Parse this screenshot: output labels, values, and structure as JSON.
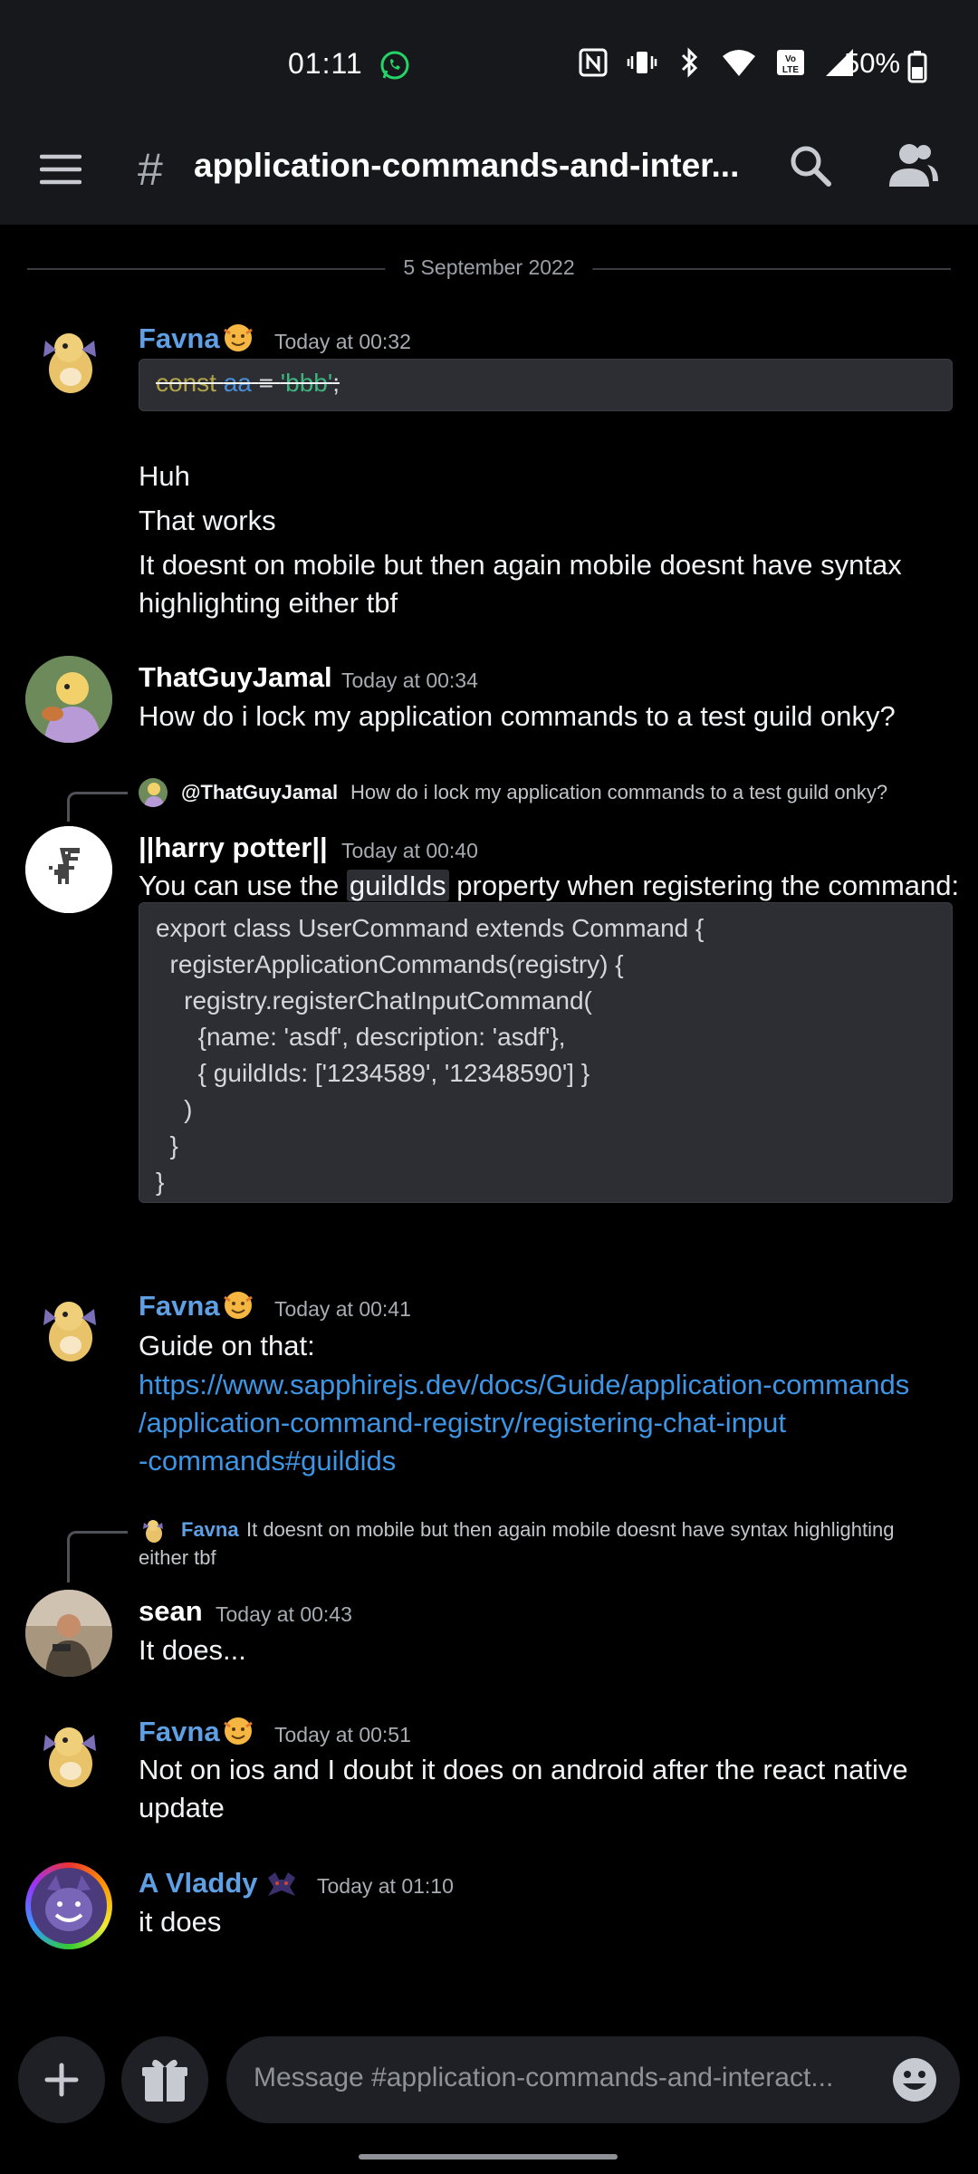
{
  "status_bar": {
    "time": "01:11",
    "battery": "50%"
  },
  "header": {
    "channel": "application-commands-and-inter...",
    "hash": "#"
  },
  "date_divider": "5 September 2022",
  "messages": {
    "m1": {
      "author": "Favna",
      "timestamp": "Today at 00:32",
      "code": {
        "k1": "const",
        "k2": "aa",
        "k3": "=",
        "k4": "'bbb'",
        "k5": ";"
      },
      "lines": [
        "Huh",
        "That works",
        "It doesnt on mobile but then again mobile doesnt have syntax",
        "highlighting either tbf"
      ]
    },
    "m2": {
      "author": "ThatGuyJamal",
      "timestamp": "Today at 00:34",
      "text": "How do i lock my application commands to a test guild onky?"
    },
    "m3": {
      "reply_author": "@ThatGuyJamal",
      "reply_text": "How do i lock my application commands to a test guild onky?",
      "author": "||harry potter||",
      "timestamp": "Today at 00:40",
      "text_before": "You can use the ",
      "inline_code": "guildIds",
      "text_after": " property when registering the command:",
      "code_lines": [
        "export class UserCommand extends Command {",
        "  registerApplicationCommands(registry) {",
        "    registry.registerChatInputCommand(",
        "      {name: 'asdf', description: 'asdf'},",
        "      { guildIds: ['1234589', '12348590'] }",
        "    )",
        "  }",
        "}"
      ]
    },
    "m4": {
      "author": "Favna",
      "timestamp": "Today at 00:41",
      "text": "Guide on that:",
      "link_lines": [
        "https://www.sapphirejs.dev/docs/Guide/application-commands",
        "/application-command-registry/registering-chat-input",
        "-commands#guildids"
      ]
    },
    "m5": {
      "reply_author": "Favna",
      "reply_text_1": "It doesnt on mobile but then again mobile doesnt have syntax highlighting",
      "reply_text_2": "either tbf",
      "author": "sean",
      "timestamp": "Today at 00:43",
      "text": "It does..."
    },
    "m6": {
      "author": "Favna",
      "timestamp": "Today at 00:51",
      "lines": [
        "Not on ios and I doubt it does on android after the react native",
        "update"
      ]
    },
    "m7": {
      "author": "A Vladdy",
      "timestamp": "Today at 01:10",
      "text": "it does"
    }
  },
  "composer": {
    "placeholder": "Message #application-commands-and-interact..."
  },
  "colors": {
    "accent_blue": "#5f9fe4",
    "link": "#3d95e5",
    "background": "#000000",
    "header": "#17181c"
  }
}
